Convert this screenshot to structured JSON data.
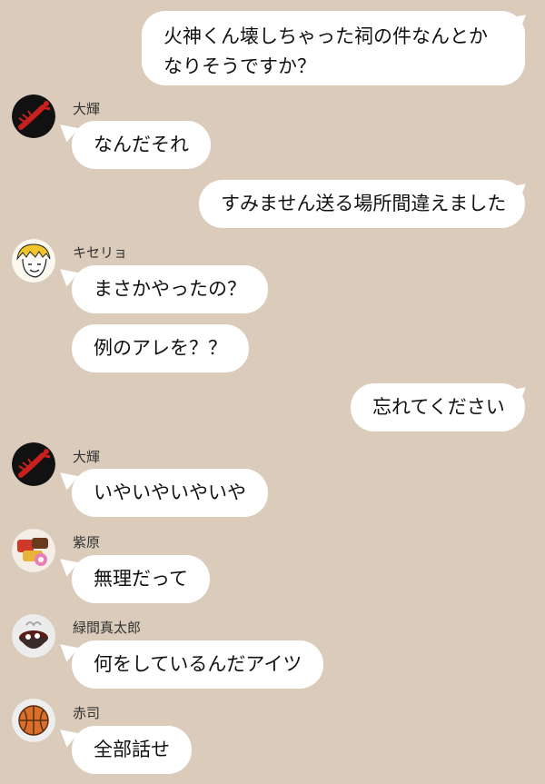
{
  "messages": [
    {
      "type": "sent",
      "text": "火神くん壊しちゃった祠の件なんとかなりそうですか？"
    },
    {
      "type": "received",
      "sender": "大輝",
      "avatar": "lobster-avatar",
      "text": "なんだそれ"
    },
    {
      "type": "sent",
      "text": "すみません送る場所間違えました"
    },
    {
      "type": "received",
      "sender": "キセリョ",
      "avatar": "blond-person-avatar",
      "text": "まさかやったの？"
    },
    {
      "type": "received",
      "text": "例のアレを？？"
    },
    {
      "type": "sent",
      "text": "忘れてください"
    },
    {
      "type": "received",
      "sender": "大輝",
      "avatar": "lobster-avatar",
      "text": "いやいやいやいや"
    },
    {
      "type": "received",
      "sender": "紫原",
      "avatar": "snacks-avatar",
      "text": "無理だって"
    },
    {
      "type": "received",
      "sender": "緑間真太郎",
      "avatar": "red-bean-soup-avatar",
      "text": "何をしているんだアイツ"
    },
    {
      "type": "received",
      "sender": "赤司",
      "avatar": "basketball-avatar",
      "text": "全部話せ"
    }
  ],
  "colors": {
    "background": "#dacbbb",
    "bubble": "#ffffff",
    "text": "#111111"
  }
}
